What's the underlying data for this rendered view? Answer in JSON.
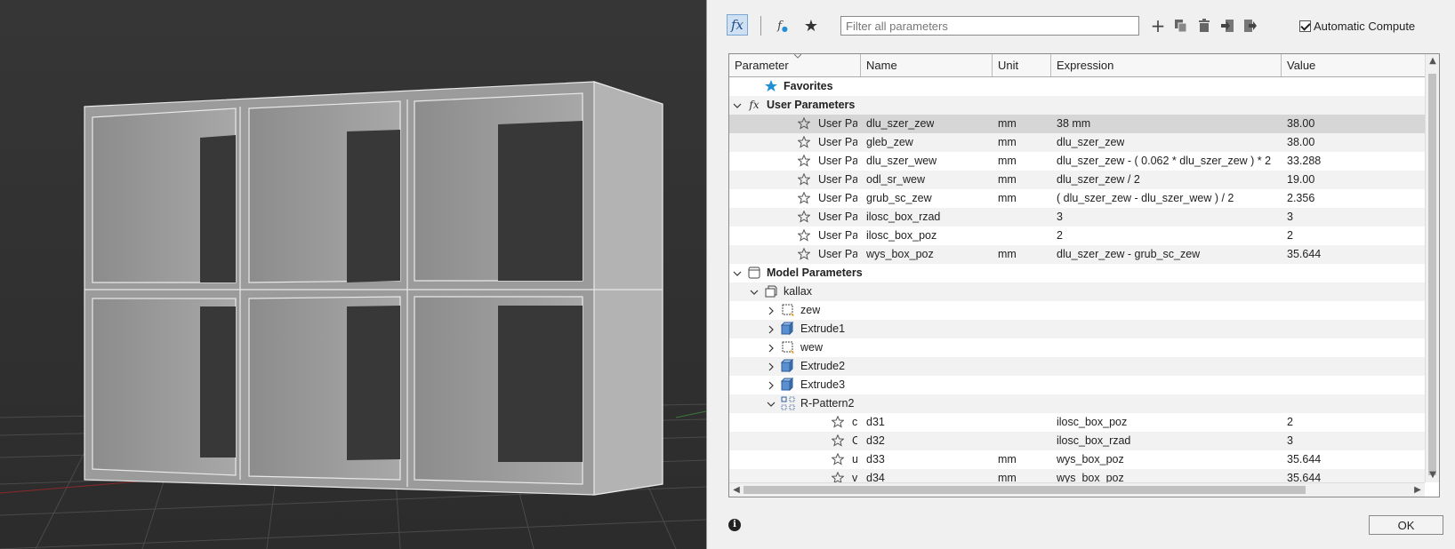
{
  "toolbar": {
    "filter_placeholder": "Filter all parameters",
    "auto_compute_label": "Automatic Compute",
    "auto_compute_checked": true,
    "fx_label": "fx",
    "fx2_label": "f",
    "icons": [
      "fx-icon",
      "user-fx-icon",
      "star-icon",
      "add-icon",
      "copy-icon",
      "delete-icon",
      "import-icon",
      "export-icon"
    ]
  },
  "columns": [
    "Parameter",
    "Name",
    "Unit",
    "Expression",
    "Value"
  ],
  "rows": [
    {
      "kind": "group",
      "icon": "star-filled",
      "label": "Favorites",
      "indent": 1,
      "chev": "none"
    },
    {
      "kind": "group",
      "icon": "fx",
      "label": "User Parameters",
      "indent": 0,
      "chev": "down"
    },
    {
      "kind": "param",
      "star": true,
      "param": "User Parame...",
      "name": "dlu_szer_zew",
      "unit": "mm",
      "expr": "38 mm",
      "value": "38.00",
      "selected": true,
      "indent": 2
    },
    {
      "kind": "param",
      "star": true,
      "param": "User Parame...",
      "name": "gleb_zew",
      "unit": "mm",
      "expr": "dlu_szer_zew",
      "value": "38.00",
      "indent": 2
    },
    {
      "kind": "param",
      "star": true,
      "param": "User Parame...",
      "name": "dlu_szer_wew",
      "unit": "mm",
      "expr": "dlu_szer_zew - ( 0.062 * dlu_szer_zew ) * 2",
      "value": "33.288",
      "indent": 2
    },
    {
      "kind": "param",
      "star": true,
      "param": "User Parame...",
      "name": "odl_sr_wew",
      "unit": "mm",
      "expr": "dlu_szer_zew / 2",
      "value": "19.00",
      "indent": 2
    },
    {
      "kind": "param",
      "star": true,
      "param": "User Parame...",
      "name": "grub_sc_zew",
      "unit": "mm",
      "expr": "( dlu_szer_zew - dlu_szer_wew ) / 2",
      "value": "2.356",
      "indent": 2
    },
    {
      "kind": "param",
      "star": true,
      "param": "User Parame...",
      "name": "ilosc_box_rzad",
      "unit": "",
      "expr": "3",
      "value": "3",
      "indent": 2
    },
    {
      "kind": "param",
      "star": true,
      "param": "User Parame...",
      "name": "ilosc_box_poz",
      "unit": "",
      "expr": "2",
      "value": "2",
      "indent": 2
    },
    {
      "kind": "param",
      "star": true,
      "param": "User Parame...",
      "name": "wys_box_poz",
      "unit": "mm",
      "expr": "dlu_szer_zew - grub_sc_zew",
      "value": "35.644",
      "indent": 2
    },
    {
      "kind": "group",
      "icon": "model",
      "label": "Model Parameters",
      "indent": 0,
      "chev": "down"
    },
    {
      "kind": "node",
      "icon": "component",
      "label": "kallax",
      "indent": 1,
      "chev": "down"
    },
    {
      "kind": "node",
      "icon": "sketch",
      "label": "zew",
      "indent": 2,
      "chev": "right"
    },
    {
      "kind": "node",
      "icon": "extrude",
      "label": "Extrude1",
      "indent": 2,
      "chev": "right"
    },
    {
      "kind": "node",
      "icon": "sketch",
      "label": "wew",
      "indent": 2,
      "chev": "right"
    },
    {
      "kind": "node",
      "icon": "extrude",
      "label": "Extrude2",
      "indent": 2,
      "chev": "right"
    },
    {
      "kind": "node",
      "icon": "extrude",
      "label": "Extrude3",
      "indent": 2,
      "chev": "right"
    },
    {
      "kind": "node",
      "icon": "pattern",
      "label": "R-Pattern2",
      "indent": 2,
      "chev": "down"
    },
    {
      "kind": "param",
      "star": true,
      "param": "countU",
      "name": "d31",
      "unit": "",
      "expr": "ilosc_box_poz",
      "value": "2",
      "indent": 4
    },
    {
      "kind": "param",
      "star": true,
      "param": "CountV",
      "name": "d32",
      "unit": "",
      "expr": "ilosc_box_rzad",
      "value": "3",
      "indent": 4
    },
    {
      "kind": "param",
      "star": true,
      "param": "uSpac...",
      "name": "d33",
      "unit": "mm",
      "expr": "wys_box_poz",
      "value": "35.644",
      "indent": 4
    },
    {
      "kind": "param",
      "star": true,
      "param": "vSpac...",
      "name": "d34",
      "unit": "mm",
      "expr": "wys_box_poz",
      "value": "35.644",
      "indent": 4
    }
  ],
  "footer": {
    "ok_label": "OK"
  },
  "colors": {
    "viewport_bg": "#383838",
    "model_face": "#9a9a9a",
    "accent": "#1f8fd6"
  }
}
